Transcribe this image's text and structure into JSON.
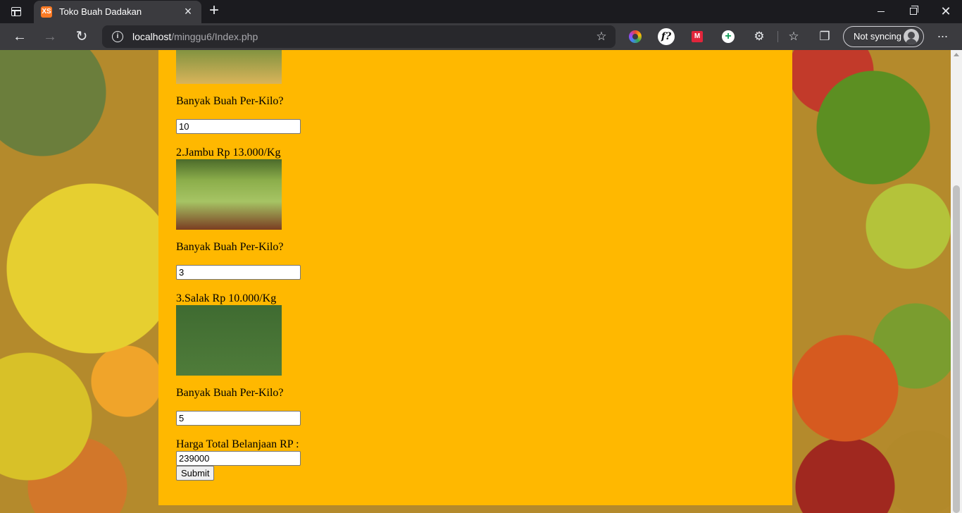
{
  "browser": {
    "tab_title": "Toko Buah Dadakan",
    "favicon_text": "XS",
    "url_host": "localhost",
    "url_path": "/minggu6/Index.php",
    "profile_label": "Not syncing"
  },
  "icons": {
    "back": "←",
    "forward": "→",
    "reload": "↻",
    "info": "i",
    "favorite_add": "☆",
    "ext_f": "f?",
    "ext_m": "M",
    "ext_plus": "+",
    "extensions": "⚙",
    "favorites": "☆",
    "collections": "❐",
    "more": "···",
    "new_tab": "+",
    "close_tab": "×",
    "close_window": "✕"
  },
  "form": {
    "quantity_label": "Banyak Buah Per-Kilo?",
    "items": [
      {
        "label": "",
        "image": "mango",
        "quantity": "10"
      },
      {
        "label": "2.Jambu Rp 13.000/Kg",
        "image": "guava",
        "quantity": "3"
      },
      {
        "label": "3.Salak Rp 10.000/Kg",
        "image": "salak",
        "quantity": "5"
      }
    ],
    "total_label": "Harga Total Belanjaan RP :",
    "total_value": "239000",
    "submit_label": "Submit"
  }
}
